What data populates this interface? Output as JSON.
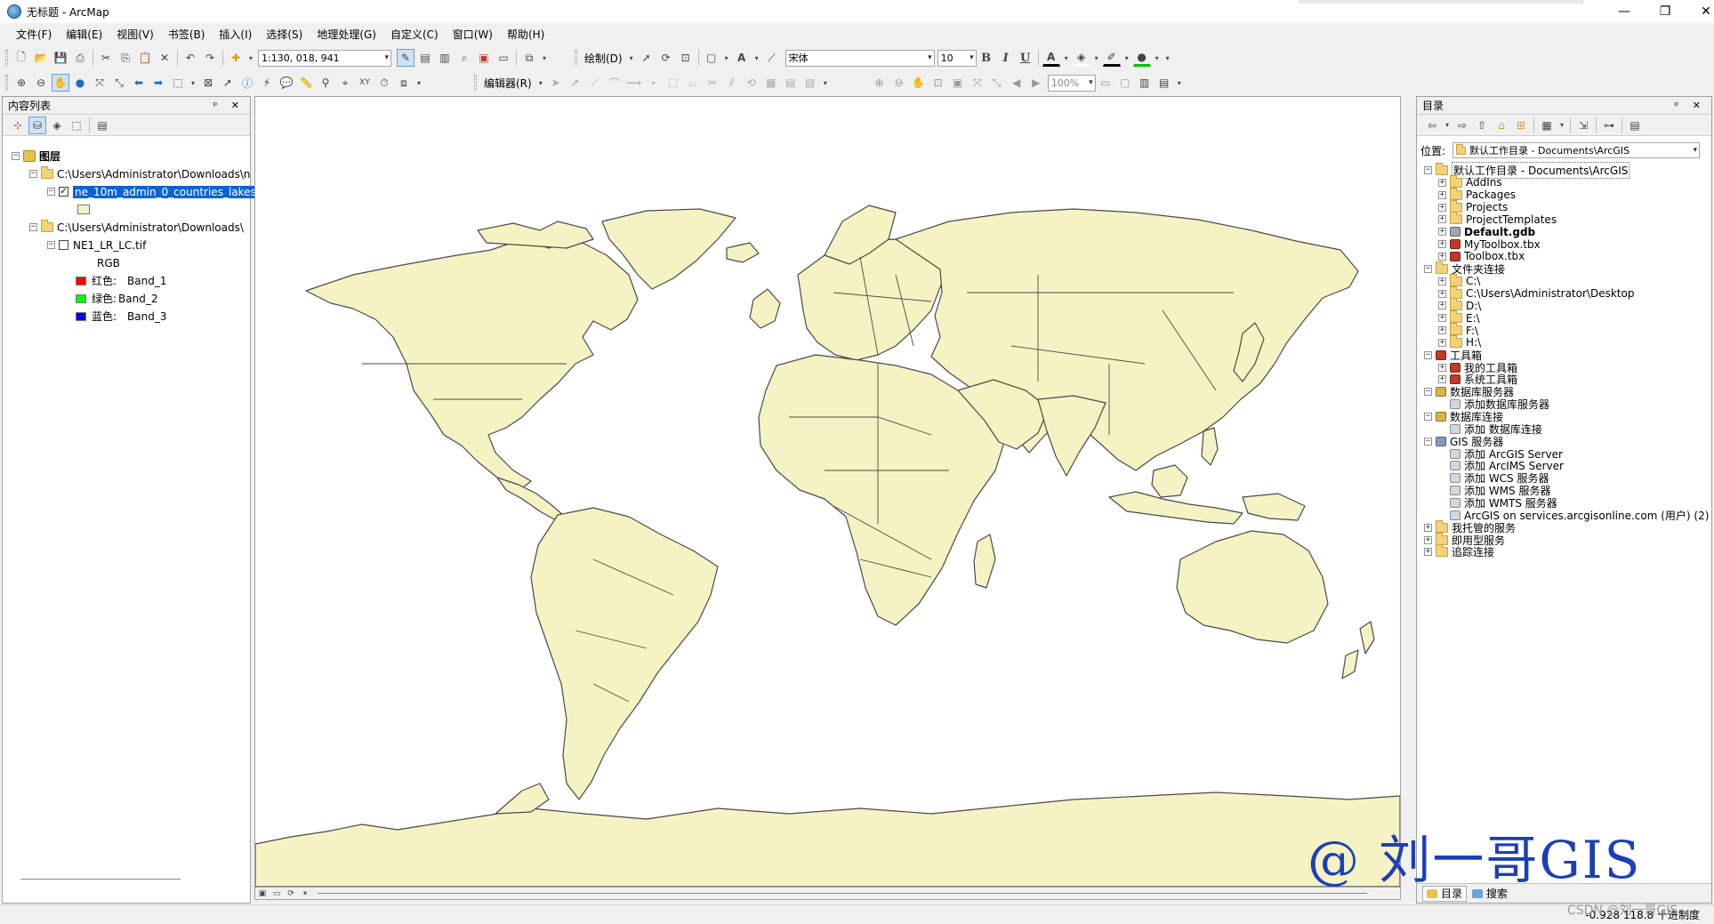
{
  "window": {
    "title": "无标题 - ArcMap",
    "minimize": "—",
    "maximize": "❐",
    "close": "✕"
  },
  "menu": [
    "文件(F)",
    "编辑(E)",
    "视图(V)",
    "书签(B)",
    "插入(I)",
    "选择(S)",
    "地理处理(G)",
    "自定义(C)",
    "窗口(W)",
    "帮助(H)"
  ],
  "toolbar": {
    "scale": "1:130, 018, 941",
    "draw_label": "绘制(D)",
    "font_name": "宋体",
    "font_size": "10",
    "bold": "B",
    "italic": "I",
    "underline": "U",
    "editor_label": "编辑器(R)",
    "zoom_percent": "100%"
  },
  "toc": {
    "title": "内容列表",
    "pin": "ᵖ ✕",
    "root": "图层",
    "group1_path": "C:\\Users\\Administrator\\Downloads\\n",
    "layer1": "ne_10m_admin_0_countries_lakes",
    "layer1_checked": true,
    "layer1_fill": "#f5f2c4",
    "group2_path": "C:\\Users\\Administrator\\Downloads\\",
    "layer2": "NE1_LR_LC.tif",
    "layer2_checked": false,
    "rgb_label": "RGB",
    "bands": [
      {
        "channel": "红色:",
        "band": "Band_1",
        "color": "#ff0000"
      },
      {
        "channel": "绿色:",
        "band": "Band_2",
        "color": "#00ff00"
      },
      {
        "channel": "蓝色:",
        "band": "Band_3",
        "color": "#0000ff"
      }
    ]
  },
  "catalog": {
    "title": "目录",
    "pin": "ᵖ ✕",
    "location_label": "位置:",
    "location_value": "默认工作目录 - Documents\\ArcGIS",
    "items": [
      {
        "label": "默认工作目录 - Documents\\ArcGIS",
        "level": 0,
        "exp": "⊟",
        "icon": "folder",
        "bold": false,
        "selected": true
      },
      {
        "label": "AddIns",
        "level": 1,
        "exp": "⊞",
        "icon": "folder"
      },
      {
        "label": "Packages",
        "level": 1,
        "exp": "⊞",
        "icon": "folder"
      },
      {
        "label": "Projects",
        "level": 1,
        "exp": "⊞",
        "icon": "folder"
      },
      {
        "label": "ProjectTemplates",
        "level": 1,
        "exp": "⊞",
        "icon": "folder"
      },
      {
        "label": "Default.gdb",
        "level": 1,
        "exp": "⊞",
        "icon": "gdb",
        "bold": true
      },
      {
        "label": "MyToolbox.tbx",
        "level": 1,
        "exp": "⊞",
        "icon": "toolbox"
      },
      {
        "label": "Toolbox.tbx",
        "level": 1,
        "exp": "⊞",
        "icon": "toolbox"
      },
      {
        "label": "文件夹连接",
        "level": 0,
        "exp": "⊟",
        "icon": "folder"
      },
      {
        "label": "C:\\",
        "level": 1,
        "exp": "⊞",
        "icon": "folder"
      },
      {
        "label": "C:\\Users\\Administrator\\Desktop",
        "level": 1,
        "exp": "⊞",
        "icon": "folder"
      },
      {
        "label": "D:\\",
        "level": 1,
        "exp": "⊞",
        "icon": "folder"
      },
      {
        "label": "E:\\",
        "level": 1,
        "exp": "⊞",
        "icon": "folder"
      },
      {
        "label": "F:\\",
        "level": 1,
        "exp": "⊞",
        "icon": "folder"
      },
      {
        "label": "H:\\",
        "level": 1,
        "exp": "⊞",
        "icon": "folder"
      },
      {
        "label": "工具箱",
        "level": 0,
        "exp": "⊟",
        "icon": "toolbox"
      },
      {
        "label": "我的工具箱",
        "level": 1,
        "exp": "⊞",
        "icon": "toolbox"
      },
      {
        "label": "系统工具箱",
        "level": 1,
        "exp": "⊞",
        "icon": "toolbox"
      },
      {
        "label": "数据库服务器",
        "level": 0,
        "exp": "⊟",
        "icon": "db"
      },
      {
        "label": "添加数据库服务器",
        "level": 1,
        "exp": "",
        "icon": "add"
      },
      {
        "label": "数据库连接",
        "level": 0,
        "exp": "⊟",
        "icon": "db"
      },
      {
        "label": "添加 数据库连接",
        "level": 1,
        "exp": "",
        "icon": "add"
      },
      {
        "label": "GIS 服务器",
        "level": 0,
        "exp": "⊟",
        "icon": "server"
      },
      {
        "label": "添加 ArcGIS Server",
        "level": 1,
        "exp": "",
        "icon": "add"
      },
      {
        "label": "添加 ArcIMS Server",
        "level": 1,
        "exp": "",
        "icon": "add"
      },
      {
        "label": "添加 WCS 服务器",
        "level": 1,
        "exp": "",
        "icon": "add"
      },
      {
        "label": "添加 WMS 服务器",
        "level": 1,
        "exp": "",
        "icon": "add"
      },
      {
        "label": "添加 WMTS 服务器",
        "level": 1,
        "exp": "",
        "icon": "add"
      },
      {
        "label": "ArcGIS on services.arcgisonline.com (用户) (2)",
        "level": 1,
        "exp": "",
        "icon": "add"
      },
      {
        "label": "我托管的服务",
        "level": 0,
        "exp": "⊞",
        "icon": "folder"
      },
      {
        "label": "即用型服务",
        "level": 0,
        "exp": "⊞",
        "icon": "folder"
      },
      {
        "label": "追踪连接",
        "level": 0,
        "exp": "⊞",
        "icon": "folder"
      }
    ],
    "tab_catalog": "目录",
    "tab_search": "搜索"
  },
  "status": {
    "coords": "-0.928  118.8 十进制度"
  },
  "watermark": "@ 刘一哥GIS",
  "csdn": "CSDN @刘一哥GIS",
  "colors": {
    "land": "#f5f2c4",
    "border": "#4a4a4a",
    "selection": "#0a64d6"
  }
}
